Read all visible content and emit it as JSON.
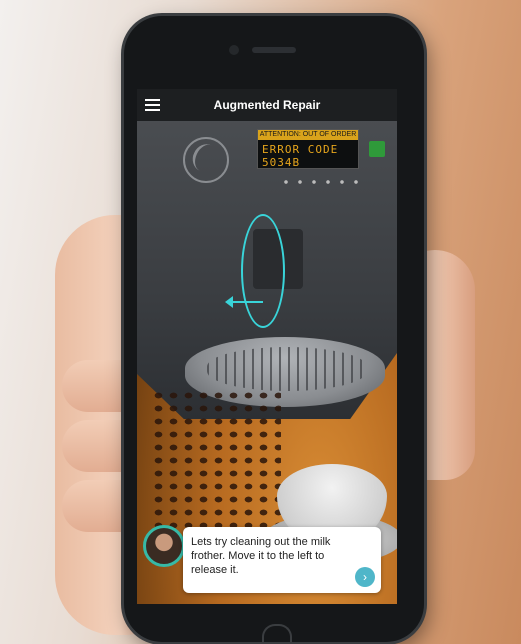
{
  "app": {
    "title": "Augmented Repair",
    "menu_icon": "hamburger-menu-icon"
  },
  "machine_display": {
    "alert": "ATTENTION: OUT OF ORDER",
    "error": "ERROR CODE 5034B"
  },
  "assistant": {
    "message": "Lets try cleaning out the milk frother. Move it to the left to release it.",
    "next_icon": "chevron-right-icon",
    "next_symbol": "›"
  },
  "colors": {
    "ar_overlay": "#39d4d9",
    "display_text": "#e6a51c",
    "assistant_accent": "#36b9a6",
    "next_button": "#4fb6c9"
  }
}
